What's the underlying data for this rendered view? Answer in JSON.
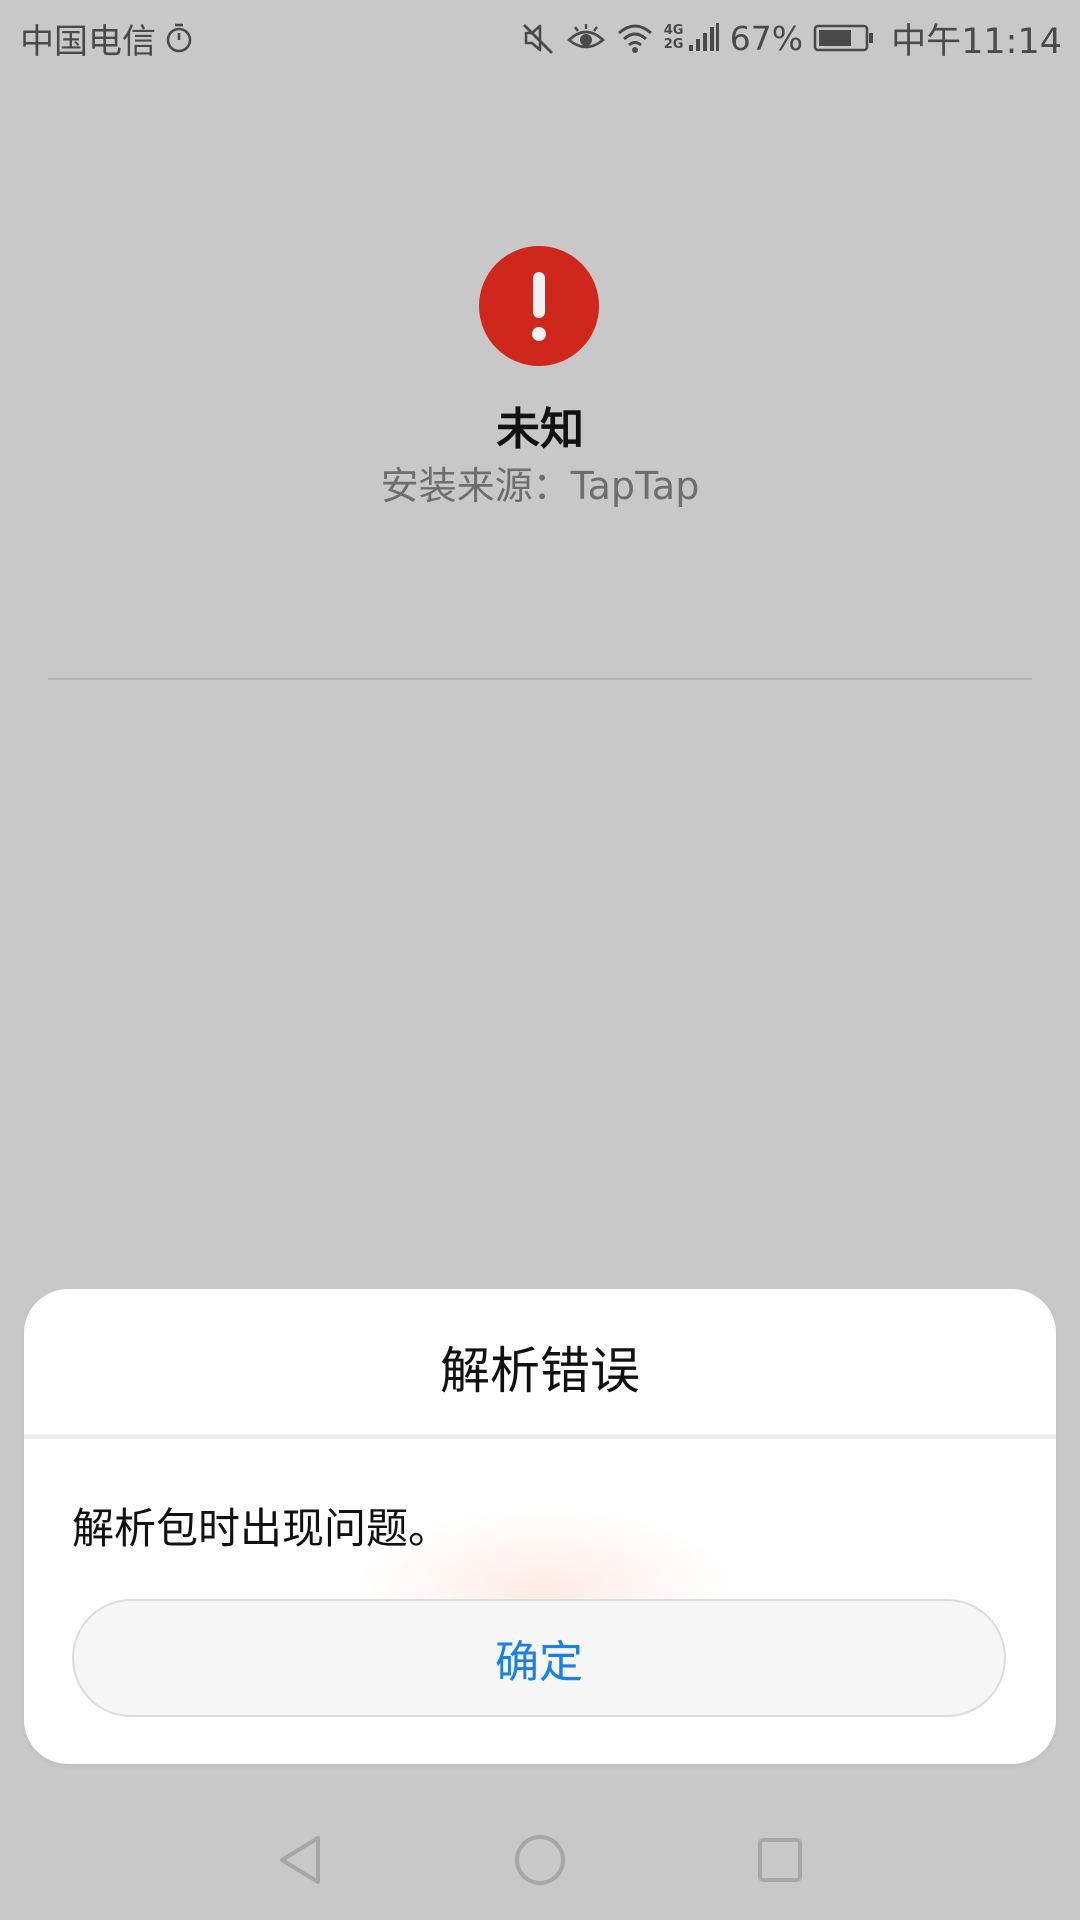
{
  "status_bar": {
    "carrier": "中国电信",
    "network": "4G 2G",
    "battery_percent": "67%",
    "time": "中午11:14",
    "icons": [
      "stopwatch-icon",
      "mute-icon",
      "eye-comfort-icon",
      "wifi-icon",
      "signal-icon",
      "battery-icon"
    ]
  },
  "app": {
    "name": "未知",
    "install_source": "安装来源：TapTap",
    "status_icon": "alert-icon",
    "alert_color": "#d0271c"
  },
  "dialog": {
    "title": "解析错误",
    "message": "解析包时出现问题。",
    "ok_label": "确定",
    "ok_color": "#1a7fe6"
  },
  "nav_bar": {
    "icons": [
      "back-icon",
      "home-icon",
      "recents-icon"
    ]
  }
}
